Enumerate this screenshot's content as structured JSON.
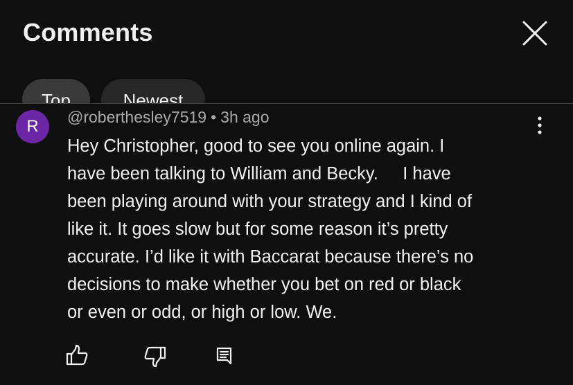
{
  "header": {
    "title": "Comments",
    "close_icon": "close-icon"
  },
  "chips": [
    {
      "label": "Top",
      "selected": true
    },
    {
      "label": "Newest",
      "selected": false
    }
  ],
  "comment": {
    "avatar_letter": "R",
    "avatar_color": "#6b26a6",
    "author": "@roberthesley7519",
    "separator": "•",
    "time": "3h ago",
    "lines": [
      "Hey Christopher, good to see you online again. I",
      "have been talking to William and Becky.     I have",
      "been playing around with your strategy and I kind of",
      "like it. It goes slow but for some reason it’s pretty",
      "accurate. I’d like it with Baccarat because there’s no",
      "decisions to make whether you bet on red or black",
      "or even or odd, or high or low. We."
    ],
    "actions": [
      "thumbs-up-icon",
      "thumbs-down-icon",
      "reply-icon"
    ],
    "more_icon": "more-vertical-icon"
  },
  "colors": {
    "background": "#0f0f0f",
    "text": "#f1f1f1",
    "secondary_text": "#aaaaaa"
  }
}
